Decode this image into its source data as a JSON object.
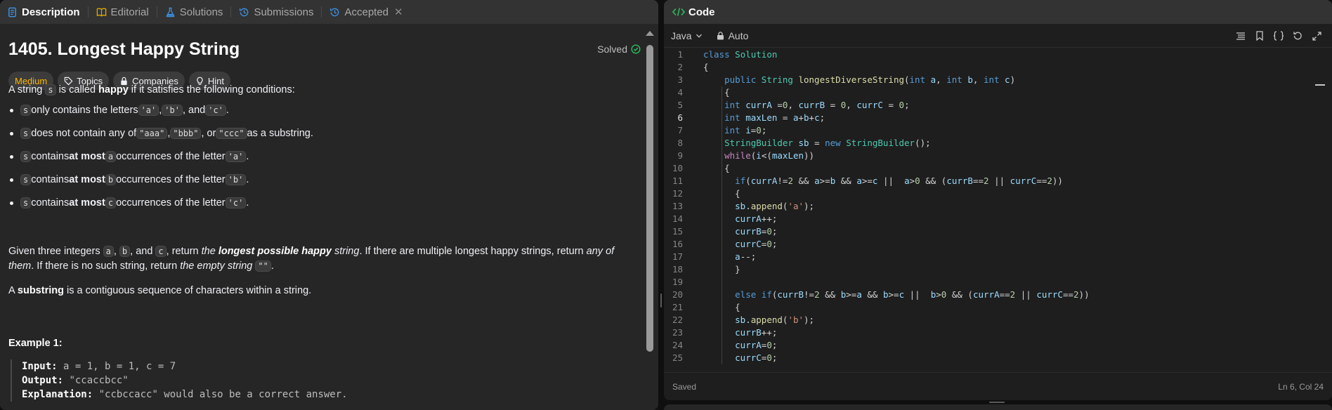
{
  "tabs": {
    "description": "Description",
    "editorial": "Editorial",
    "solutions": "Solutions",
    "submissions": "Submissions",
    "accepted": "Accepted",
    "close": "✕"
  },
  "problem": {
    "title": "1405. Longest Happy String",
    "status": "Solved",
    "difficulty": "Medium",
    "chips": {
      "topics": "Topics",
      "companies": "Companies",
      "hint": "Hint"
    },
    "intro": {
      "pre": "A string ",
      "s": "s",
      "mid": " is called ",
      "happy": "happy",
      "post": " if it satisfies the following conditions:"
    },
    "bullets": {
      "b1": {
        "s": "s",
        "t1": " only contains the letters ",
        "c1": "'a'",
        "t2": ", ",
        "c2": "'b'",
        "t3": ", and ",
        "c3": "'c'",
        "t4": "."
      },
      "b2": {
        "s": "s",
        "t1": " does not contain any of ",
        "c1": "\"aaa\"",
        "t2": ", ",
        "c2": "\"bbb\"",
        "t3": ", or ",
        "c3": "\"ccc\"",
        "t4": " as a substring."
      },
      "b3": {
        "s": "s",
        "t1": " contains ",
        "bold": "at most",
        "t2": " ",
        "v": "a",
        "t3": " occurrences of the letter ",
        "c": "'a'",
        "t4": "."
      },
      "b4": {
        "s": "s",
        "t1": " contains ",
        "bold": "at most",
        "t2": " ",
        "v": "b",
        "t3": " occurrences of the letter ",
        "c": "'b'",
        "t4": "."
      },
      "b5": {
        "s": "s",
        "t1": " contains ",
        "bold": "at most",
        "t2": " ",
        "v": "c",
        "t3": " occurrences of the letter ",
        "c": "'c'",
        "t4": "."
      }
    },
    "given": {
      "t1": "Given three integers ",
      "a": "a",
      "t2": ", ",
      "b": "b",
      "t3": ", and ",
      "c": "c",
      "t4": ", return ",
      "i1": "the ",
      "bi": "longest possible happy",
      "i2": " string",
      "t5": ". If there are multiple longest happy strings, return ",
      "i3": "any of them",
      "t6": ". If there is no such string, return ",
      "i4": "the empty string",
      "t7": " ",
      "empty": "\"\"",
      "t8": "."
    },
    "substring": {
      "bold": "substring",
      "rest": " is a contiguous sequence of characters within a string."
    },
    "example": {
      "title": "Example 1:",
      "input_label": "Input:",
      "input": " a = 1, b = 1, c = 7",
      "output_label": "Output:",
      "output": " \"ccaccbcc\"",
      "explanation_label": "Explanation:",
      "explanation": " \"ccbccacc\" would also be a correct answer."
    }
  },
  "code_panel": {
    "title": "Code",
    "language": "Java",
    "auto": "Auto",
    "status_left": "Saved",
    "status_right": "Ln 6, Col 24",
    "current_line": 6,
    "lines": [
      "class Solution",
      "{",
      "    public String longestDiverseString(int a, int b, int c)",
      "    {",
      "    int currA =0, currB = 0, currC = 0;",
      "    int maxLen = a+b+c;",
      "    int i=0;",
      "    StringBuilder sb = new StringBuilder();",
      "    while(i<(maxLen))",
      "    {",
      "      if(currA!=2 && a>=b && a>=c ||  a>0 && (currB==2 || currC==2))",
      "      {",
      "      sb.append('a');",
      "      currA++;",
      "      currB=0;",
      "      currC=0;",
      "      a--;",
      "      }",
      "",
      "      else if(currB!=2 && b>=a && b>=c ||  b>0 && (currA==2 || currC==2))",
      "      {",
      "      sb.append('b');",
      "      currB++;",
      "      currA=0;",
      "      currC=0;"
    ]
  }
}
